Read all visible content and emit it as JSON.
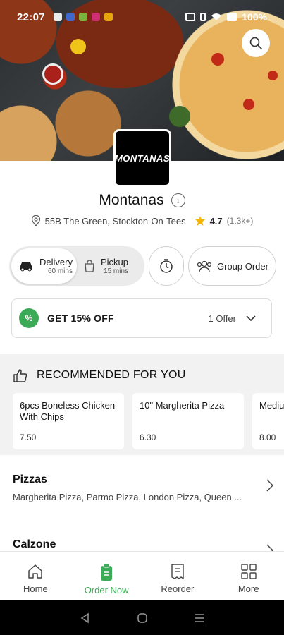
{
  "status_bar": {
    "time": "22:07",
    "battery": "100%"
  },
  "shop": {
    "name": "Montanas",
    "logo_text": "MONTANAS",
    "address": "55B The Green, Stockton-On-Tees",
    "rating": "4.7",
    "rating_count": "(1.3k+)"
  },
  "mode": {
    "delivery": {
      "label": "Delivery",
      "time": "60 mins"
    },
    "pickup": {
      "label": "Pickup",
      "time": "15 mins"
    },
    "group_order": "Group Order"
  },
  "offer": {
    "badge": "%",
    "title": "GET 15% OFF",
    "count": "1 Offer"
  },
  "recommended": {
    "title": "RECOMMENDED FOR YOU",
    "items": [
      {
        "name": "6pcs Boneless Chicken With Chips",
        "price": "7.50"
      },
      {
        "name": "10\" Margherita Pizza",
        "price": "6.30"
      },
      {
        "name": "Medium Parmo",
        "price": "8.00"
      }
    ]
  },
  "categories": [
    {
      "title": "Pizzas",
      "items": "Margherita Pizza, Parmo Pizza, London Pizza, Queen ..."
    },
    {
      "title": "Calzone",
      "items": ""
    }
  ],
  "bottom_nav": [
    {
      "label": "Home",
      "icon": "home-icon"
    },
    {
      "label": "Order Now",
      "icon": "order-bag-icon"
    },
    {
      "label": "Reorder",
      "icon": "receipt-icon"
    },
    {
      "label": "More",
      "icon": "grid-icon"
    }
  ],
  "colors": {
    "accent": "#3cab57"
  }
}
